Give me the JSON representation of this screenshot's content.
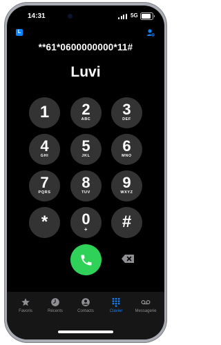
{
  "status_bar": {
    "time": "14:31",
    "network": "5G"
  },
  "sim_badge": "L",
  "dialed_number": "**61*0600000000*11#",
  "contact_name": "Luvi",
  "keypad": [
    {
      "digit": "1",
      "letters": ""
    },
    {
      "digit": "2",
      "letters": "ABC"
    },
    {
      "digit": "3",
      "letters": "DEF"
    },
    {
      "digit": "4",
      "letters": "GHI"
    },
    {
      "digit": "5",
      "letters": "JKL"
    },
    {
      "digit": "6",
      "letters": "MNO"
    },
    {
      "digit": "7",
      "letters": "PQRS"
    },
    {
      "digit": "8",
      "letters": "TUV"
    },
    {
      "digit": "9",
      "letters": "WXYZ"
    },
    {
      "digit": "*",
      "letters": ""
    },
    {
      "digit": "0",
      "letters": "+"
    },
    {
      "digit": "#",
      "letters": ""
    }
  ],
  "tabs": [
    {
      "label": "Favoris",
      "icon": "star-icon",
      "active": false
    },
    {
      "label": "Récents",
      "icon": "clock-icon",
      "active": false
    },
    {
      "label": "Contacts",
      "icon": "person-icon",
      "active": false
    },
    {
      "label": "Clavier",
      "icon": "keypad-icon",
      "active": true
    },
    {
      "label": "Messagerie",
      "icon": "voicemail-icon",
      "active": false
    }
  ],
  "colors": {
    "accent": "#0a84ff",
    "call_button": "#30d158",
    "key_background": "#333333",
    "tab_inactive": "#8e8e93"
  }
}
